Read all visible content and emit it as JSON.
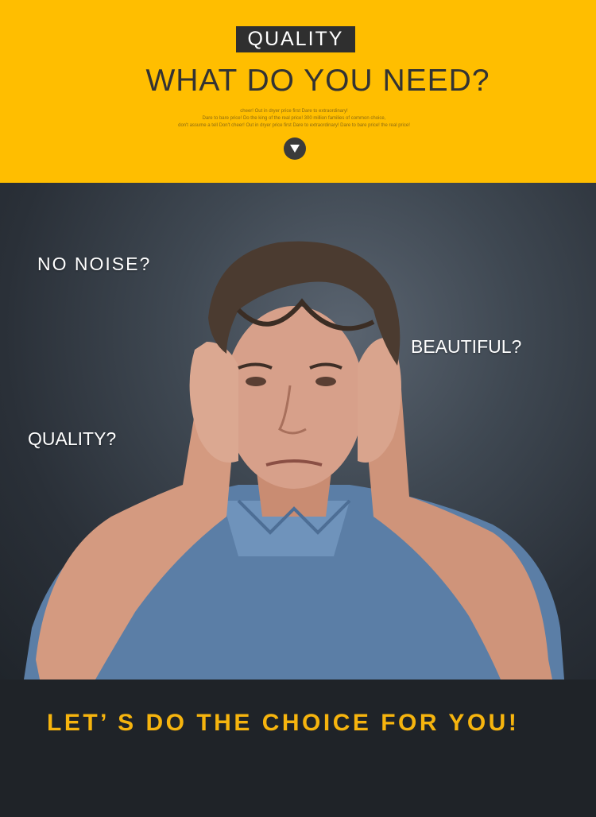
{
  "banner": {
    "badge": "QUALITY",
    "headline": "WHAT DO YOU NEED?",
    "fineprint": [
      "cheer! Out in dryer price first Dare to extraordinary!",
      "Dare to bare price! Do the king of the real price! 300 million families of common choice,",
      "don't assume a tell Don't cheer! Out in dryer price first Dare to extraordinary! Dare to bare price! the real price!"
    ],
    "down_icon": "▼"
  },
  "photo": {
    "labels": {
      "no_noise": "NO NOISE?",
      "beautiful": "BEAUTIFUL?",
      "quality": "QUALITY?"
    }
  },
  "footer": {
    "slogan": "LET’ S DO THE CHOICE FOR YOU!"
  },
  "colors": {
    "banner_yellow": "#ffbe00",
    "badge_dark": "#2f2f2f",
    "slogan_gold": "#f6b40e",
    "bottom_dark": "#1f2328"
  }
}
